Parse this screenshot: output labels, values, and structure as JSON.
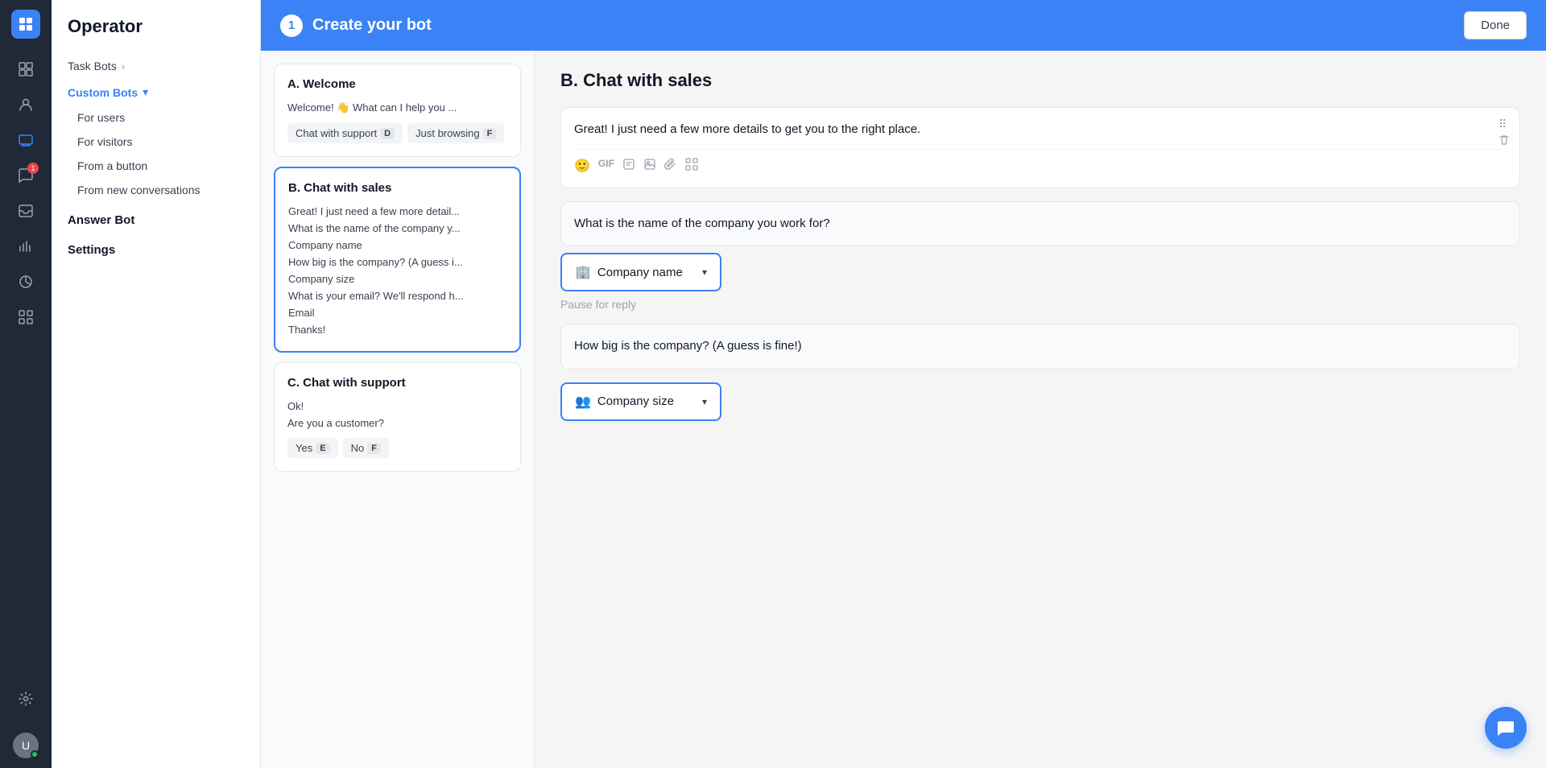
{
  "app": {
    "logo": "≡",
    "title": "Operator"
  },
  "header": {
    "step_number": "1",
    "title": "Create your bot",
    "done_button": "Done"
  },
  "sidebar": {
    "title": "Operator",
    "task_bots_label": "Task Bots",
    "custom_bots_label": "Custom Bots",
    "sub_items": [
      {
        "label": "For users"
      },
      {
        "label": "For visitors"
      },
      {
        "label": "From a button"
      },
      {
        "label": "From new conversations"
      }
    ],
    "answer_bot_label": "Answer Bot",
    "settings_label": "Settings"
  },
  "rail_icons": [
    {
      "icon": "⊞",
      "name": "dashboard-icon"
    },
    {
      "icon": "👤",
      "name": "contacts-icon"
    },
    {
      "icon": "🔧",
      "name": "operator-icon"
    },
    {
      "icon": "💬",
      "name": "messages-icon",
      "badge": "1"
    },
    {
      "icon": "☰",
      "name": "reports-icon"
    },
    {
      "icon": "📊",
      "name": "analytics-icon"
    },
    {
      "icon": "⊞",
      "name": "apps-icon"
    },
    {
      "icon": "🔔",
      "name": "notifications-icon"
    }
  ],
  "cards": [
    {
      "id": "card-a",
      "title": "A. Welcome",
      "items": [
        {
          "text": "Welcome! 👋  What can I help you ...",
          "dim": false
        }
      ],
      "options": [
        {
          "label": "Chat with support",
          "badge": "D"
        },
        {
          "label": "Just browsing",
          "badge": "F"
        }
      ],
      "selected": false
    },
    {
      "id": "card-b",
      "title": "B. Chat with sales",
      "items": [
        {
          "text": "Great! I just need a few more detail...",
          "dim": false
        },
        {
          "text": "What is the name of the company y...",
          "dim": false
        },
        {
          "text": "Company name",
          "dim": false
        },
        {
          "text": "How big is the company? (A guess i...",
          "dim": false
        },
        {
          "text": "Company size",
          "dim": false
        },
        {
          "text": "What is your email? We'll respond h...",
          "dim": false
        },
        {
          "text": "Email",
          "dim": false
        },
        {
          "text": "Thanks!",
          "dim": false
        }
      ],
      "selected": true
    },
    {
      "id": "card-c",
      "title": "C. Chat with support",
      "items": [
        {
          "text": "Ok!",
          "dim": false
        },
        {
          "text": "Are you a customer?",
          "dim": false
        }
      ],
      "options": [
        {
          "label": "Yes",
          "badge": "E"
        },
        {
          "label": "No",
          "badge": "F"
        }
      ],
      "selected": false
    }
  ],
  "detail": {
    "title": "B. Chat with sales",
    "messages": [
      {
        "id": "msg-1",
        "text": "Great! I just need a few more details to get you to the right place.",
        "has_toolbar": true,
        "has_actions": true
      }
    ],
    "question_1": {
      "text": "What is the name of the company you work for?"
    },
    "save_reply_1": {
      "icon": "🏢",
      "label": "Company name",
      "has_arrow": true
    },
    "pause_label": "Pause for reply",
    "question_2": {
      "text": "How big is the company? (A guess is fine!)"
    },
    "save_reply_2": {
      "icon": "👥",
      "label": "Company size",
      "has_arrow": true
    }
  },
  "toolbar_icons": [
    {
      "name": "emoji-icon",
      "symbol": "🙂"
    },
    {
      "name": "gif-icon",
      "symbol": "GIF"
    },
    {
      "name": "note-icon",
      "symbol": "📋"
    },
    {
      "name": "image-icon",
      "symbol": "🖼"
    },
    {
      "name": "attachment-icon",
      "symbol": "📎"
    },
    {
      "name": "apps-tool-icon",
      "symbol": "⊞"
    }
  ]
}
